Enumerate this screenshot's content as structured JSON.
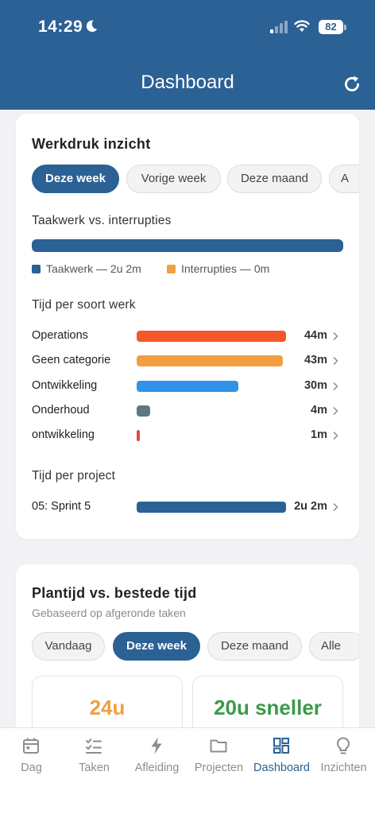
{
  "status_bar": {
    "time": "14:29",
    "battery": "82"
  },
  "header": {
    "title": "Dashboard",
    "refresh_icon": "refresh-icon"
  },
  "workload": {
    "title": "Werkdruk inzicht",
    "tabs": [
      {
        "label": "Deze week",
        "active": true
      },
      {
        "label": "Vorige week",
        "active": false
      },
      {
        "label": "Deze maand",
        "active": false
      },
      {
        "label": "A",
        "active": false
      }
    ],
    "task_vs_interrupt": {
      "title": "Taakwerk vs. interrupties",
      "taakwerk_fraction": 1.0,
      "legend": [
        {
          "label": "Taakwerk — 2u 2m",
          "color": "#2b6194"
        },
        {
          "label": "Interrupties — 0m",
          "color": "#f0a040"
        }
      ]
    },
    "per_type": {
      "title": "Tijd per soort werk",
      "rows": [
        {
          "label": "Operations",
          "value": "44m",
          "minutes": 44,
          "color": "#f5572a"
        },
        {
          "label": "Geen categorie",
          "value": "43m",
          "minutes": 43,
          "color": "#f0a040"
        },
        {
          "label": "Ontwikkeling",
          "value": "30m",
          "minutes": 30,
          "color": "#2f93e8"
        },
        {
          "label": "Onderhoud",
          "value": "4m",
          "minutes": 4,
          "color": "#5f7785"
        },
        {
          "label": "ontwikkeling",
          "value": "1m",
          "minutes": 1,
          "color": "#e24a4a"
        }
      ]
    },
    "per_project": {
      "title": "Tijd per project",
      "rows": [
        {
          "label": "05: Sprint 5",
          "value": "2u 2m",
          "fraction": 1.0,
          "color": "#2b6194"
        }
      ]
    }
  },
  "planning": {
    "title": "Plantijd vs. bestede tijd",
    "subtitle": "Gebaseerd op afgeronde taken",
    "tabs": [
      {
        "label": "Vandaag",
        "active": false
      },
      {
        "label": "Deze week",
        "active": true
      },
      {
        "label": "Deze maand",
        "active": false
      },
      {
        "label": "Alle",
        "active": false
      }
    ],
    "stats": [
      {
        "value": "24u",
        "color": "#f0a040"
      },
      {
        "value": "20u sneller",
        "color": "#3a9a4a"
      }
    ]
  },
  "tabbar": {
    "items": [
      {
        "label": "Dag",
        "icon": "calendar-icon",
        "active": false
      },
      {
        "label": "Taken",
        "icon": "checklist-icon",
        "active": false
      },
      {
        "label": "Afleiding",
        "icon": "bolt-icon",
        "active": false
      },
      {
        "label": "Projecten",
        "icon": "folder-icon",
        "active": false
      },
      {
        "label": "Dashboard",
        "icon": "dashboard-icon",
        "active": true
      },
      {
        "label": "Inzichten",
        "icon": "lightbulb-icon",
        "active": false
      }
    ]
  }
}
